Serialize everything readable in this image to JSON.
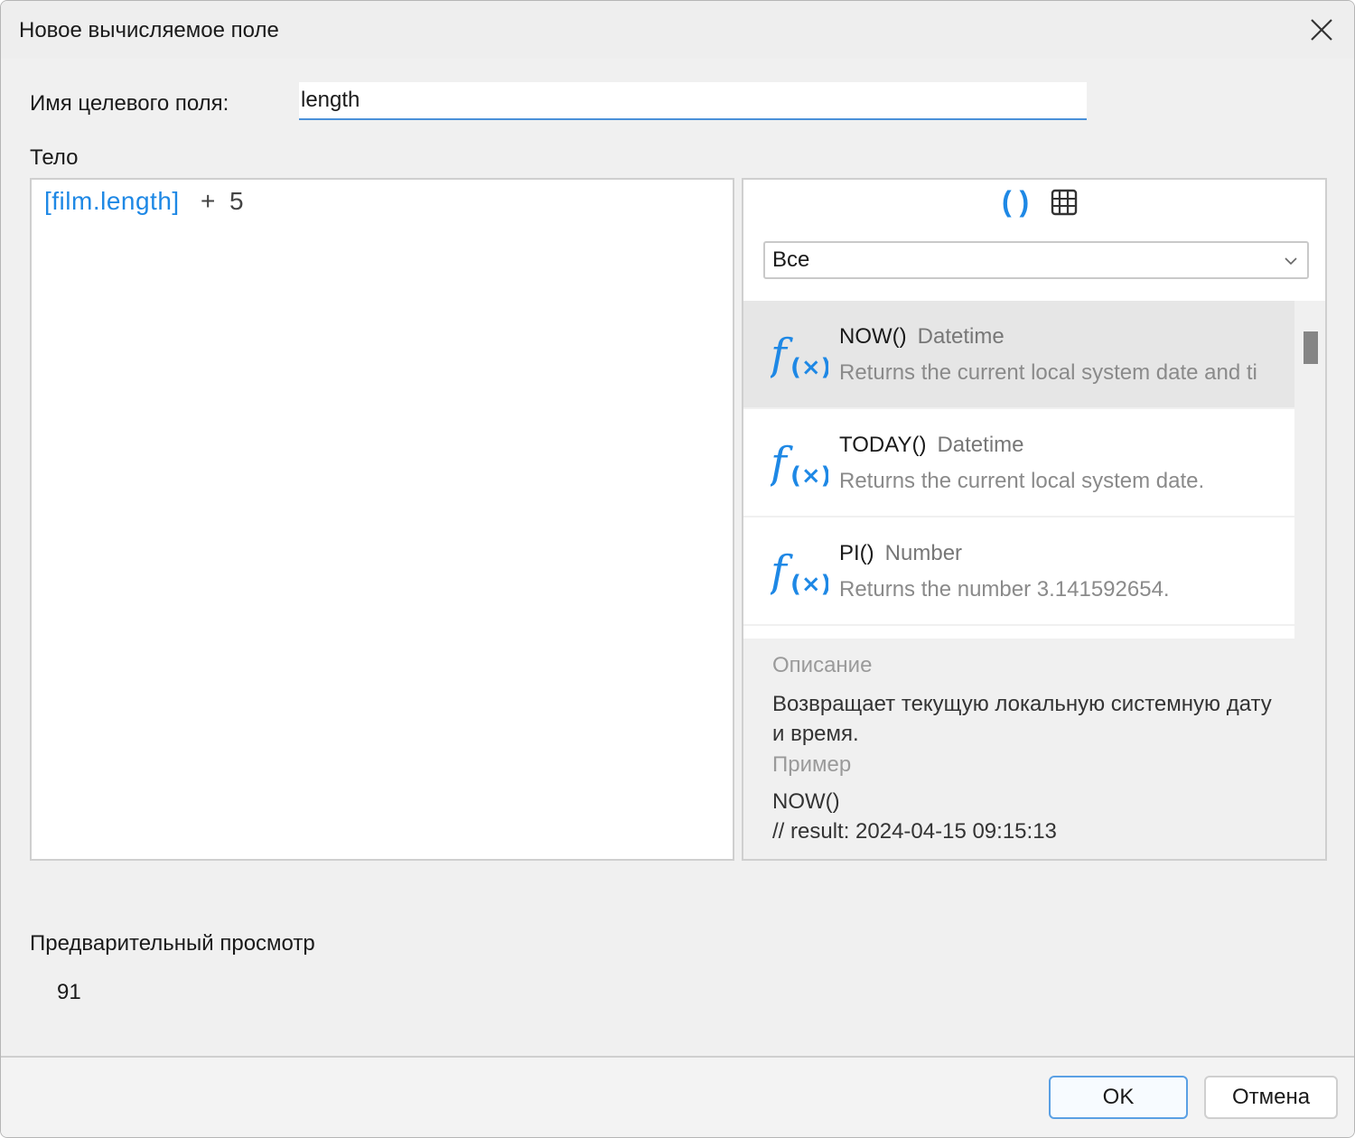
{
  "window": {
    "title": "Новое вычисляемое поле"
  },
  "target_field": {
    "label": "Имя целевого поля:",
    "value": "length"
  },
  "body": {
    "label": "Тело",
    "expression": {
      "field": "[film.length]",
      "operator": "+",
      "number": "5"
    }
  },
  "function_panel": {
    "category": "Все",
    "functions": [
      {
        "name": "NOW()",
        "type": "Datetime",
        "description": "Returns the current local system date and ti",
        "selected": true
      },
      {
        "name": "TODAY()",
        "type": "Datetime",
        "description": "Returns the current local system date.",
        "selected": false
      },
      {
        "name": "PI()",
        "type": "Number",
        "description": "Returns the number 3.141592654.",
        "selected": false
      }
    ],
    "details": {
      "description_heading": "Описание",
      "description_line1": "Возвращает текущую локальную системную дату",
      "description_line2": "и время.",
      "example_heading": "Пример",
      "example_line1": "NOW()",
      "example_line2": "// result: 2024-04-15 09:15:13"
    }
  },
  "preview": {
    "label": "Предварительный просмотр",
    "value": "91"
  },
  "buttons": {
    "ok": "OK",
    "cancel": "Отмена"
  },
  "colors": {
    "accent": "#1e88e5",
    "selected_row": "#e6e6e6",
    "dialog_bg": "#f0f0f0"
  }
}
